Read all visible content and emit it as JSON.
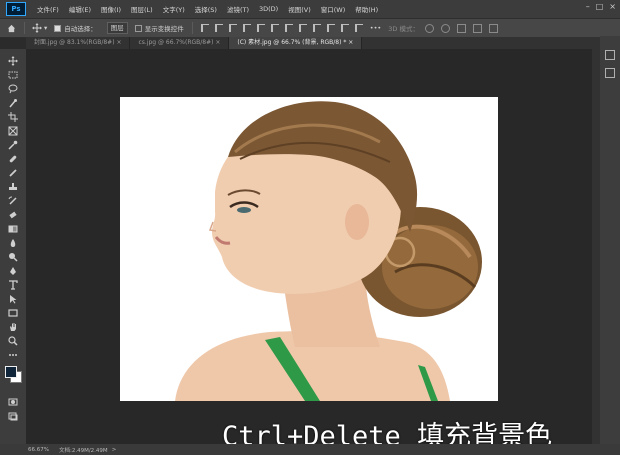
{
  "menubar": {
    "logo": "Ps",
    "items": [
      "文件(F)",
      "编辑(E)",
      "图像(I)",
      "图层(L)",
      "文字(Y)",
      "选择(S)",
      "滤镜(T)",
      "3D(D)",
      "视图(V)",
      "窗口(W)",
      "帮助(H)"
    ],
    "window_controls": [
      "–",
      "□",
      "×"
    ]
  },
  "options": {
    "auto_select_label": "自动选择：",
    "auto_select_value": "图层",
    "show_transform_label": "显示变换控件",
    "more_label": "•••",
    "mode_3d_label": "3D 模式："
  },
  "tabs": [
    {
      "label": "封面.jpg @ 83.1%(RGB/8#) ×",
      "active": false
    },
    {
      "label": "cs.jpg @ 66.7%(RGB/8#) ×",
      "active": false
    },
    {
      "label": "(C) 素材.jpg @ 66.7% (背景, RGB/8) * ×",
      "active": true
    }
  ],
  "status": {
    "zoom": "66.67%",
    "doc": "文档:2.49M/2.49M",
    "arrow": ">"
  },
  "caption": "Ctrl+Delete 填充背景色",
  "colors": {
    "foreground": "#10243a",
    "background": "#ffffff"
  },
  "icons": [
    "move-icon",
    "marquee-icon",
    "lasso-icon",
    "quick-select-icon",
    "crop-icon",
    "frame-icon",
    "eyedropper-icon",
    "healing-icon",
    "brush-icon",
    "stamp-icon",
    "history-brush-icon",
    "eraser-icon",
    "gradient-icon",
    "blur-icon",
    "dodge-icon",
    "pen-icon",
    "type-icon",
    "path-select-icon",
    "rectangle-icon",
    "hand-icon",
    "zoom-icon",
    "more-tools-icon"
  ]
}
